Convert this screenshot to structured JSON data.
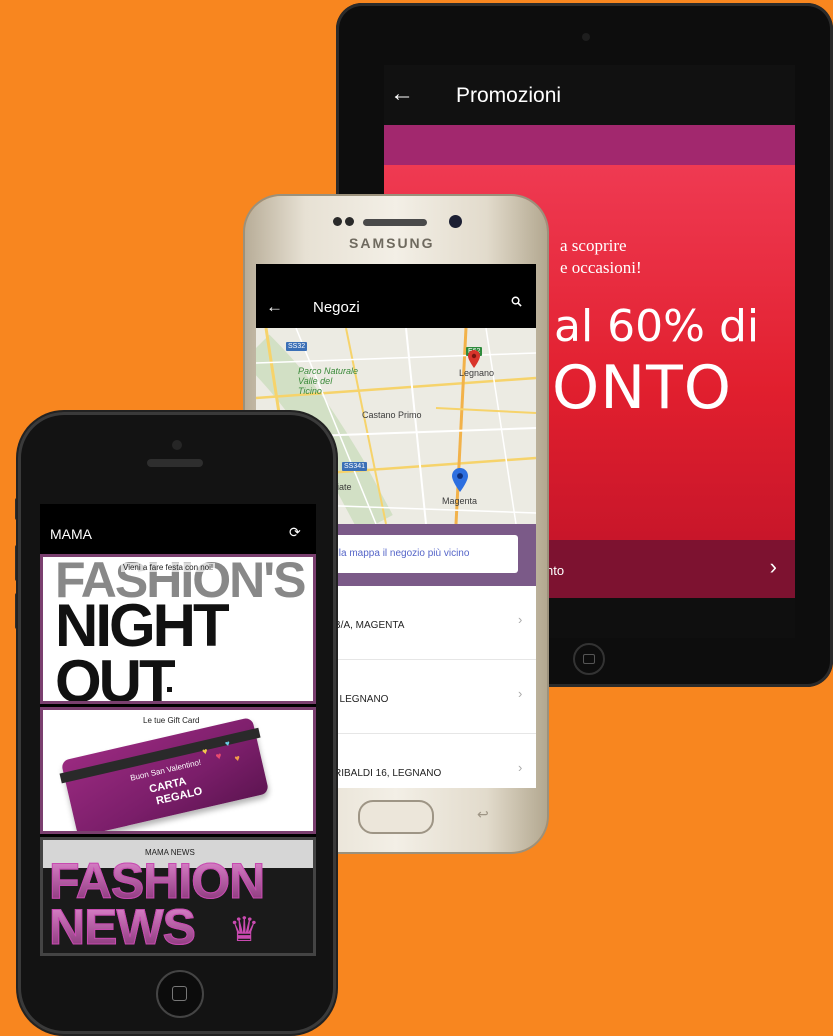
{
  "tablet": {
    "header": {
      "back_icon": "arrow-left-icon",
      "title": "Promozioni"
    },
    "promo": {
      "line1": "a scoprire",
      "line2": "e occasioni!",
      "headline1": "al 60% di",
      "headline2": "ONTO"
    },
    "action": {
      "label": "nto",
      "chevron": "›"
    }
  },
  "samsung": {
    "brand": "SAMSUNG",
    "header": {
      "title": "Negozi",
      "back_icon": "arrow-left-icon",
      "search_icon": "search-icon"
    },
    "map": {
      "labels": {
        "park": "Parco Naturale\nValle del\nTicino",
        "legnano": "Legnano",
        "castano": "Castano Primo",
        "magenta": "Magenta",
        "villiate": "illiate"
      },
      "badges": {
        "ss532": "SS32",
        "e62": "E62",
        "ss341": "SS341"
      }
    },
    "find_button": "sulla mappa il negozio più vicino",
    "stores": [
      {
        "label": "B/A, MAGENTA"
      },
      {
        "label": ", LEGNANO"
      },
      {
        "label": "RIBALDI 16, LEGNANO"
      }
    ],
    "chevron": "›"
  },
  "iphone": {
    "header": {
      "title": "MAMA",
      "refresh_icon": "refresh-icon"
    },
    "cards": {
      "fno": {
        "caption": "Vieni a fare festa con noi!",
        "line1": "FASHION'S",
        "line2": "NIGHT",
        "line3": "OUT"
      },
      "gift": {
        "caption": "Le tue Gift Card",
        "card_line1": "Buon San Valentino!",
        "card_line2": "CARTA",
        "card_line3": "REGALO"
      },
      "news": {
        "caption": "MAMA NEWS",
        "line1": "FASHION",
        "line2": "NEWS"
      }
    }
  },
  "colors": {
    "background": "#F8861F",
    "promo_red": "#E8242F",
    "store_purple": "#7B5A88",
    "mama_purple": "#7A3F6F"
  }
}
